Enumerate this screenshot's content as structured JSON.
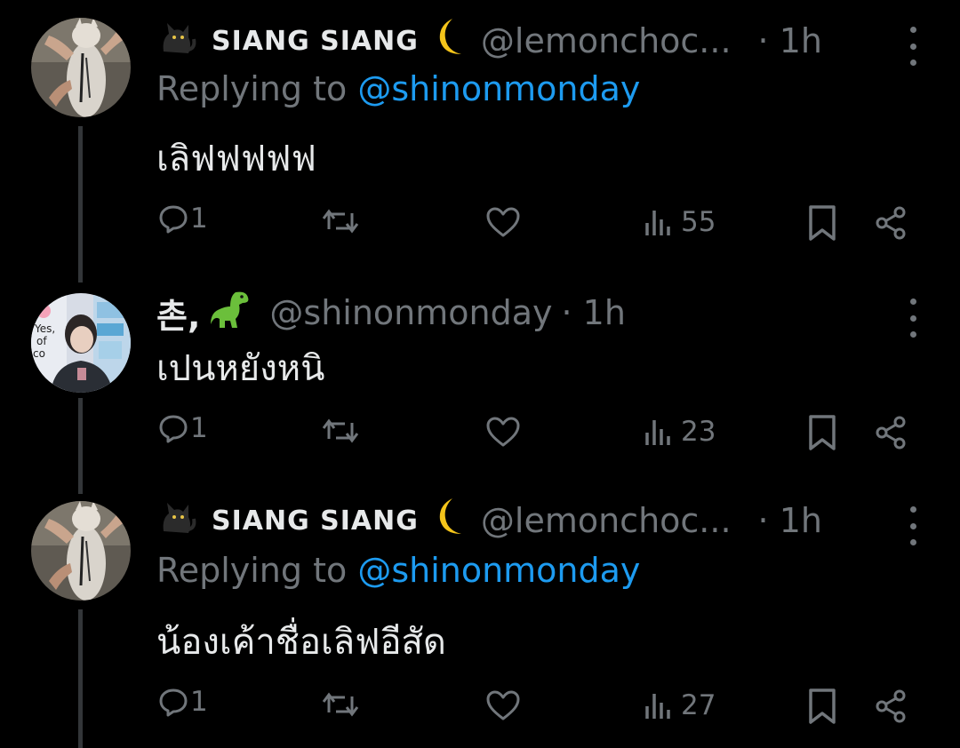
{
  "tweets": [
    {
      "name": "SIANG SIANG",
      "name_prefix_icon": "black-cat-icon",
      "name_suffix_icon": "crescent-moon-icon",
      "handle": "@lemonchoc...",
      "time": "· 1h",
      "replying_prefix": "Replying to ",
      "replying_to": "@shinonmonday",
      "text": "เลิฟฟฟฟฟ",
      "replies": "1",
      "views": "55"
    },
    {
      "name": "촌,",
      "name_suffix_icon": "dinosaur-icon",
      "handle": "@shinonmonday",
      "time": "· 1h",
      "text": "เปนหยังหนิ",
      "replies": "1",
      "views": "23"
    },
    {
      "name": "SIANG SIANG",
      "name_prefix_icon": "black-cat-icon",
      "name_suffix_icon": "crescent-moon-icon",
      "handle": "@lemonchoc...",
      "time": "· 1h",
      "replying_prefix": "Replying to ",
      "replying_to": "@shinonmonday",
      "text": "น้องเค้าชื่อเลิฟอีสัด",
      "replies": "1",
      "views": "27"
    }
  ],
  "colors": {
    "background": "#000000",
    "text": "#e7e9ea",
    "muted": "#71767b",
    "link": "#1d9bf0",
    "thread_line": "#333639"
  }
}
